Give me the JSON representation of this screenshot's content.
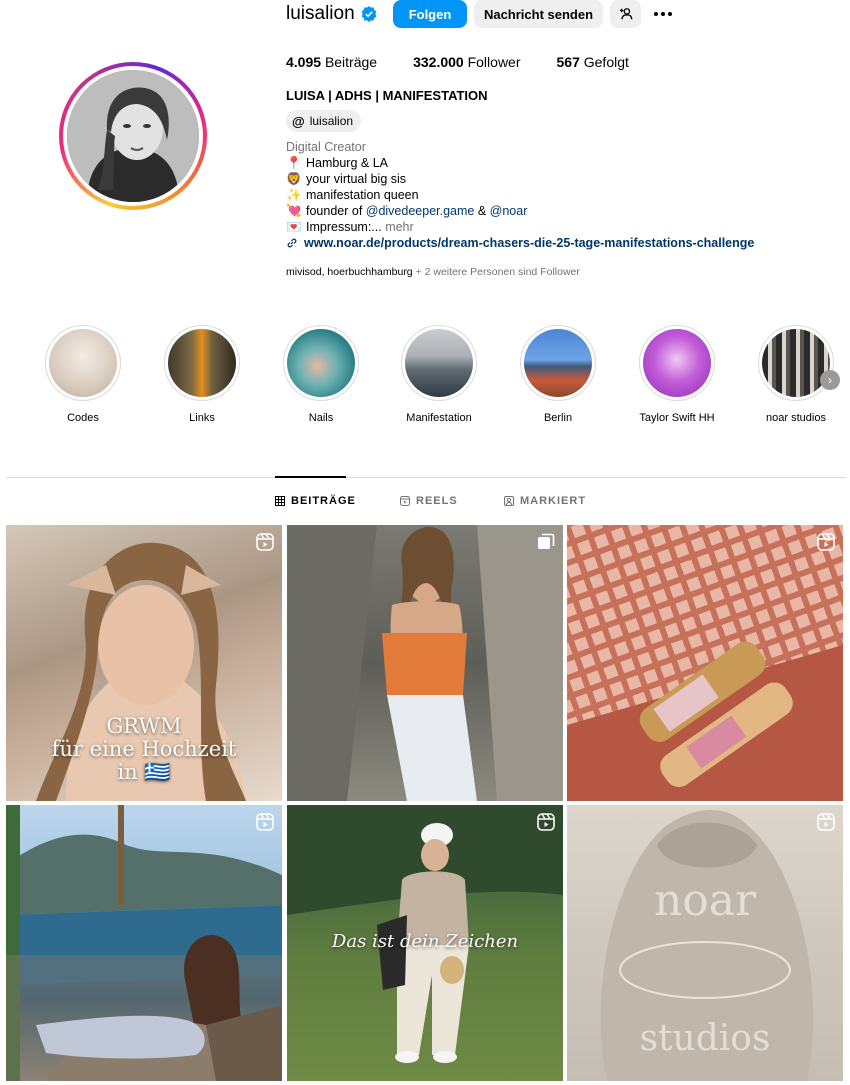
{
  "profile": {
    "username": "luisalion",
    "verified_icon": "verified-badge-icon",
    "follow_label": "Folgen",
    "message_label": "Nachricht senden",
    "add_user_icon": "add-user-icon",
    "more_icon": "more-options-icon",
    "stats": {
      "posts_count": "4.095",
      "posts_label": "Beiträge",
      "followers_count": "332.000",
      "followers_label": "Follower",
      "following_count": "567",
      "following_label": "Gefolgt"
    },
    "full_name": "LUISA | ADHS | MANIFESTATION",
    "threads_handle": "luisalion",
    "bio": {
      "category": "Digital Creator",
      "line1_emoji": "📍",
      "line1": "Hamburg & LA",
      "line2_emoji": "🦁",
      "line2": "your virtual big sis",
      "line3_emoji": "✨",
      "line3": "manifestation queen",
      "line4_emoji": "💘",
      "line4_prefix": "founder of ",
      "line4_mention1": "@divedeeper.game",
      "line4_mid": " & ",
      "line4_mention2": "@noar",
      "line5_emoji": "💌",
      "line5": "Impressum:... ",
      "line5_more": "mehr"
    },
    "website": "www.noar.de/products/dream-chasers-die-25-tage-manifestations-challenge",
    "followed_by_names": "mivisod, hoerbuchhamburg",
    "followed_by_rest": " + 2 weitere Personen sind Follower"
  },
  "highlights": [
    {
      "label": "Codes"
    },
    {
      "label": "Links"
    },
    {
      "label": "Nails"
    },
    {
      "label": "Manifestation"
    },
    {
      "label": "Berlin"
    },
    {
      "label": "Taylor Swift HH"
    },
    {
      "label": "noar studios"
    }
  ],
  "tabs": {
    "posts": "BEITRÄGE",
    "reels": "REELS",
    "tagged": "MARKIERT"
  },
  "posts": [
    {
      "type": "reel",
      "overlay_line1": "GRWM",
      "overlay_line2": "für eine Hochzeit",
      "overlay_line3": "in 🇬🇷"
    },
    {
      "type": "carousel"
    },
    {
      "type": "reel"
    },
    {
      "type": "reel"
    },
    {
      "type": "reel",
      "overlay_text": "Das ist dein Zeichen"
    },
    {
      "type": "reel",
      "hoodie_text_top": "noar",
      "hoodie_text_bottom": "studios"
    }
  ],
  "colors": {
    "accent": "#0095f6",
    "link": "#00376b",
    "muted": "#737373",
    "button_bg": "#efefef"
  }
}
